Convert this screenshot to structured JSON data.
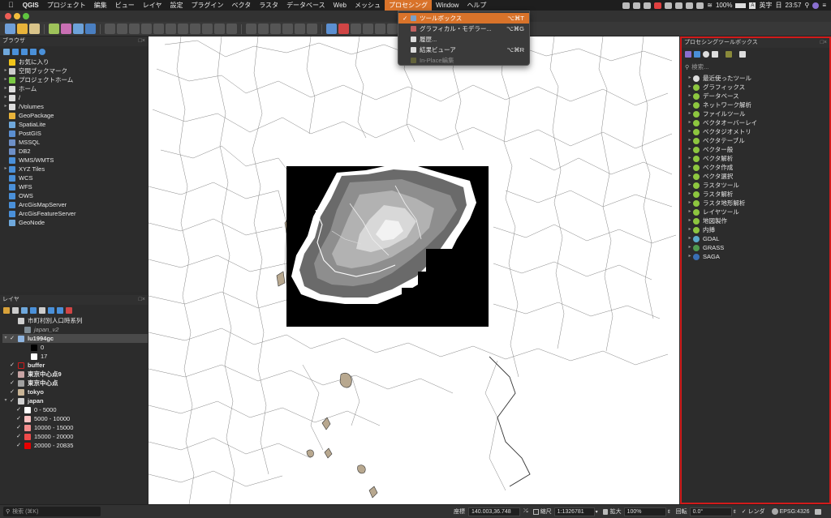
{
  "menubar": {
    "app": "QGIS",
    "items": [
      "プロジェクト",
      "編集",
      "ビュー",
      "レイヤ",
      "設定",
      "プラグイン",
      "ベクタ",
      "ラスタ",
      "データベース",
      "Web",
      "メッシュ",
      "プロセシング",
      "Window",
      "ヘルプ"
    ],
    "active_index": 11,
    "battery": "100%",
    "input_mode": "英字",
    "day": "日",
    "time": "23:57"
  },
  "processing_menu": {
    "items": [
      {
        "label": "ツールボックス",
        "shortcut": "⌥⌘T",
        "checked": true,
        "selected": true,
        "enabled": true,
        "icon": "gear-icon"
      },
      {
        "label": "グラフィカル・モデラー...",
        "shortcut": "⌥⌘G",
        "checked": false,
        "selected": false,
        "enabled": true,
        "icon": "model-icon"
      },
      {
        "label": "履歴...",
        "shortcut": "",
        "checked": false,
        "selected": false,
        "enabled": true,
        "icon": "history-icon"
      },
      {
        "label": "結果ビューア",
        "shortcut": "⌥⌘R",
        "checked": false,
        "selected": false,
        "enabled": true,
        "icon": "results-icon"
      },
      {
        "label": "In-Place編集",
        "shortcut": "",
        "checked": false,
        "selected": false,
        "enabled": false,
        "icon": "edit-in-place-icon"
      }
    ]
  },
  "browser": {
    "title": "ブラウザ",
    "items": [
      {
        "label": "お気に入り",
        "icon": "star-icon",
        "color": "#f0c419",
        "arrow": false
      },
      {
        "label": "空間ブックマーク",
        "icon": "bookmark-icon",
        "color": "#cccccc",
        "arrow": true
      },
      {
        "label": "プロジェクトホーム",
        "icon": "project-home-icon",
        "color": "#7ac943",
        "arrow": true
      },
      {
        "label": "ホーム",
        "icon": "home-folder-icon",
        "color": "#dddddd",
        "arrow": true
      },
      {
        "label": "/",
        "icon": "folder-icon",
        "color": "#dddddd",
        "arrow": true
      },
      {
        "label": "/Volumes",
        "icon": "folder-icon",
        "color": "#dddddd",
        "arrow": true
      },
      {
        "label": "GeoPackage",
        "icon": "geopackage-icon",
        "color": "#e8b33a",
        "arrow": false
      },
      {
        "label": "SpatiaLite",
        "icon": "spatialite-icon",
        "color": "#6fa8dc",
        "arrow": false
      },
      {
        "label": "PostGIS",
        "icon": "postgis-icon",
        "color": "#5b8fd1",
        "arrow": false
      },
      {
        "label": "MSSQL",
        "icon": "mssql-icon",
        "color": "#6d8fc7",
        "arrow": false
      },
      {
        "label": "DB2",
        "icon": "db2-icon",
        "color": "#6d8fc7",
        "arrow": false
      },
      {
        "label": "WMS/WMTS",
        "icon": "wms-icon",
        "color": "#4a90d9",
        "arrow": false
      },
      {
        "label": "XYZ Tiles",
        "icon": "xyz-tiles-icon",
        "color": "#4a90d9",
        "arrow": true
      },
      {
        "label": "WCS",
        "icon": "wcs-icon",
        "color": "#4a90d9",
        "arrow": false
      },
      {
        "label": "WFS",
        "icon": "wfs-icon",
        "color": "#4a90d9",
        "arrow": false
      },
      {
        "label": "OWS",
        "icon": "ows-icon",
        "color": "#4a90d9",
        "arrow": false
      },
      {
        "label": "ArcGisMapServer",
        "icon": "arcgis-map-icon",
        "color": "#4a90d9",
        "arrow": false
      },
      {
        "label": "ArcGisFeatureServer",
        "icon": "arcgis-feature-icon",
        "color": "#4a90d9",
        "arrow": false
      },
      {
        "label": "GeoNode",
        "icon": "geonode-icon",
        "color": "#6fa8dc",
        "arrow": false
      }
    ]
  },
  "layers": {
    "title": "レイヤ",
    "items": [
      {
        "label": "市町村別人口時系列",
        "indent": 0,
        "check": "",
        "arrow": "",
        "swatch": "#cfcfcf",
        "bold": false,
        "italic": false,
        "selected": false
      },
      {
        "label": "japan_v2",
        "indent": 1,
        "check": "",
        "arrow": "",
        "swatch": "#7f8c95",
        "bold": false,
        "italic": true,
        "selected": false
      },
      {
        "label": "lu1994gc",
        "indent": 0,
        "check": "✓",
        "arrow": "▾",
        "swatch": "#8fb5e0",
        "bold": true,
        "italic": false,
        "selected": true
      },
      {
        "label": "0",
        "indent": 2,
        "check": "",
        "arrow": "",
        "swatch": "#000000",
        "bold": false,
        "italic": false,
        "selected": false
      },
      {
        "label": "17",
        "indent": 2,
        "check": "",
        "arrow": "",
        "swatch": "#ffffff",
        "bold": false,
        "italic": false,
        "selected": false
      },
      {
        "label": "buffer",
        "indent": 0,
        "check": "✓",
        "arrow": "",
        "swatch": "#2c2c2c",
        "bold": true,
        "italic": false,
        "selected": false
      },
      {
        "label": "東京中心点9",
        "indent": 0,
        "check": "✓",
        "arrow": "",
        "swatch": "#c8a4a4",
        "bold": true,
        "italic": false,
        "selected": false
      },
      {
        "label": "東京中心点",
        "indent": 0,
        "check": "✓",
        "arrow": "",
        "swatch": "#a0a0a0",
        "bold": true,
        "italic": false,
        "selected": false
      },
      {
        "label": "tokyo",
        "indent": 0,
        "check": "✓",
        "arrow": "",
        "swatch": "#c8b496",
        "bold": true,
        "italic": false,
        "selected": false
      },
      {
        "label": "japan",
        "indent": 0,
        "check": "✓",
        "arrow": "▾",
        "swatch": "#d0d0d0",
        "bold": true,
        "italic": false,
        "selected": false
      },
      {
        "label": "0 - 5000",
        "indent": 1,
        "check": "✓",
        "arrow": "",
        "swatch": "#ffffff",
        "bold": false,
        "italic": false,
        "selected": false
      },
      {
        "label": "5000 - 10000",
        "indent": 1,
        "check": "✓",
        "arrow": "",
        "swatch": "#fbc3c3",
        "bold": false,
        "italic": false,
        "selected": false
      },
      {
        "label": "10000 - 15000",
        "indent": 1,
        "check": "✓",
        "arrow": "",
        "swatch": "#f58d8d",
        "bold": false,
        "italic": false,
        "selected": false
      },
      {
        "label": "15000 - 20000",
        "indent": 1,
        "check": "✓",
        "arrow": "",
        "swatch": "#ef4a4a",
        "bold": false,
        "italic": false,
        "selected": false
      },
      {
        "label": "20000 - 20835",
        "indent": 1,
        "check": "✓",
        "arrow": "",
        "swatch": "#e80000",
        "bold": false,
        "italic": false,
        "selected": false
      }
    ]
  },
  "toolbox": {
    "title": "プロセシングツールボックス",
    "search_placeholder": "検索...",
    "items": [
      {
        "label": "最近使ったツール",
        "icon": "clock-icon",
        "color": "#dddddd"
      },
      {
        "label": "グラフィックス",
        "icon": "qgis-algorithm-icon",
        "color": "#8dc63f"
      },
      {
        "label": "データベース",
        "icon": "qgis-algorithm-icon",
        "color": "#8dc63f"
      },
      {
        "label": "ネットワーク解析",
        "icon": "qgis-algorithm-icon",
        "color": "#8dc63f"
      },
      {
        "label": "ファイルツール",
        "icon": "qgis-algorithm-icon",
        "color": "#8dc63f"
      },
      {
        "label": "ベクタオーバーレイ",
        "icon": "qgis-algorithm-icon",
        "color": "#8dc63f"
      },
      {
        "label": "ベクタジオメトリ",
        "icon": "qgis-algorithm-icon",
        "color": "#8dc63f"
      },
      {
        "label": "ベクタテーブル",
        "icon": "qgis-algorithm-icon",
        "color": "#8dc63f"
      },
      {
        "label": "ベクター般",
        "icon": "qgis-algorithm-icon",
        "color": "#8dc63f"
      },
      {
        "label": "ベクタ解析",
        "icon": "qgis-algorithm-icon",
        "color": "#8dc63f"
      },
      {
        "label": "ベクタ作成",
        "icon": "qgis-algorithm-icon",
        "color": "#8dc63f"
      },
      {
        "label": "ベクタ選択",
        "icon": "qgis-algorithm-icon",
        "color": "#8dc63f"
      },
      {
        "label": "ラスタツール",
        "icon": "qgis-algorithm-icon",
        "color": "#8dc63f"
      },
      {
        "label": "ラスタ解析",
        "icon": "qgis-algorithm-icon",
        "color": "#8dc63f"
      },
      {
        "label": "ラスタ地形解析",
        "icon": "qgis-algorithm-icon",
        "color": "#8dc63f"
      },
      {
        "label": "レイヤツール",
        "icon": "qgis-algorithm-icon",
        "color": "#8dc63f"
      },
      {
        "label": "地図製作",
        "icon": "qgis-algorithm-icon",
        "color": "#8dc63f"
      },
      {
        "label": "内挿",
        "icon": "qgis-algorithm-icon",
        "color": "#8dc63f"
      },
      {
        "label": "GDAL",
        "icon": "gdal-icon",
        "color": "#5aa9c9"
      },
      {
        "label": "GRASS",
        "icon": "grass-icon",
        "color": "#4f9a4f"
      },
      {
        "label": "SAGA",
        "icon": "saga-icon",
        "color": "#3a6fb5"
      }
    ]
  },
  "statusbar": {
    "search_placeholder": "検索 (⌘K)",
    "coord_label": "座標",
    "coord_value": "140.003,36.748",
    "scale_label": "縮尺",
    "scale_value": "1:1326781",
    "magnifier_label": "拡大",
    "magnifier_value": "100%",
    "rotation_label": "回転",
    "rotation_value": "0.0°",
    "render_label": "レンダ",
    "crs_label": "EPSG:4326"
  },
  "colors": {
    "accent": "#d9732a",
    "toolbox_border": "#d11b1b",
    "map_background": "#ffffff",
    "island_fill": "#b8a88f"
  }
}
